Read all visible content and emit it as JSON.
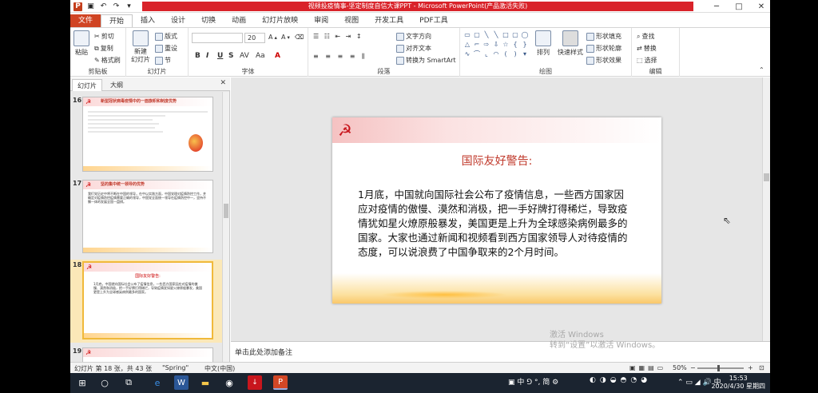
{
  "window": {
    "title": "视频投疫情事-坚定制度自信大课PPT - Microsoft PowerPoint(产品激活失败)"
  },
  "tabs": [
    "文件",
    "开始",
    "插入",
    "设计",
    "切换",
    "动画",
    "幻灯片放映",
    "审阅",
    "视图",
    "开发工具",
    "PDF工具"
  ],
  "active_tab": "开始",
  "ribbon": {
    "clipboard": {
      "label": "剪贴板",
      "paste": "粘贴",
      "cut": "剪切",
      "copy": "复制",
      "format_painter": "格式刷"
    },
    "slides": {
      "label": "幻灯片",
      "new_slide": "新建\n幻灯片",
      "layout": "版式",
      "reset": "重设",
      "section": "节"
    },
    "font": {
      "label": "字体",
      "font_name": "",
      "font_size": "20"
    },
    "paragraph": {
      "label": "段落",
      "text_direction": "文字方向",
      "align_text": "对齐文本",
      "convert_smartart": "转换为 SmartArt"
    },
    "drawing": {
      "label": "绘图",
      "arrange": "排列",
      "quick_styles": "快速样式",
      "shape_fill": "形状填充",
      "shape_outline": "形状轮廓",
      "shape_effects": "形状效果"
    },
    "editing": {
      "label": "编辑",
      "find": "查找",
      "replace": "替换",
      "select": "选择"
    }
  },
  "left_panel": {
    "tabs": [
      "幻灯片",
      "大纲"
    ],
    "slides": [
      {
        "num": "16",
        "title": "新型冠状病毒疫情中的一面旗帜和制度优势"
      },
      {
        "num": "17",
        "title": "坚的集中统一领导的优势",
        "body": "我们党历史中将不断在中国的领导，在中以实践方面，中国党理对疫情防控工作，并确定对疫情防控疫情需要正确的领导，中国党全面统一领导在疫情防控中一，坚持不懈一体的发展全国一盘棋。"
      },
      {
        "num": "18",
        "title": "国际友好警告:",
        "body": "1月底，中国就向国际社会公布了疫情信息，一些西方国家因应对疫情的傲慢、漠然和消极，把一手好牌打得稀烂，导致疫情犹如星火燎原般暴发，美国更是上升为全球感染病例最多的国家。"
      },
      {
        "num": "19",
        "title": ""
      }
    ]
  },
  "slide": {
    "title": "国际友好警告:",
    "body": "1月底，中国就向国际社会公布了疫情信息，一些西方国家因应对疫情的傲慢、漠然和消极，把一手好牌打得稀烂，导致疫情犹如星火燎原般暴发，美国更是上升为全球感染病例最多的国家。大家也通过新闻和视频看到西方国家领导人对待疫情的态度，可以说浪费了中国争取来的2个月时间。"
  },
  "notes": {
    "placeholder": "单击此处添加备注"
  },
  "watermark": {
    "line1": "激活 Windows",
    "line2": "转到“设置”以激活 Windows。"
  },
  "status": {
    "slide_info": "幻灯片 第 18 张，共 43 张",
    "theme": "\"Spring\"",
    "language": "中文(中国)",
    "zoom": "50%"
  },
  "taskbar": {
    "time": "15:53",
    "date": "2020/4/30 星期四",
    "ime": "中",
    "ime2": "简"
  },
  "colors": {
    "accent": "#c0392b",
    "file_tab": "#d04423",
    "title_strip": "#d9232a"
  }
}
